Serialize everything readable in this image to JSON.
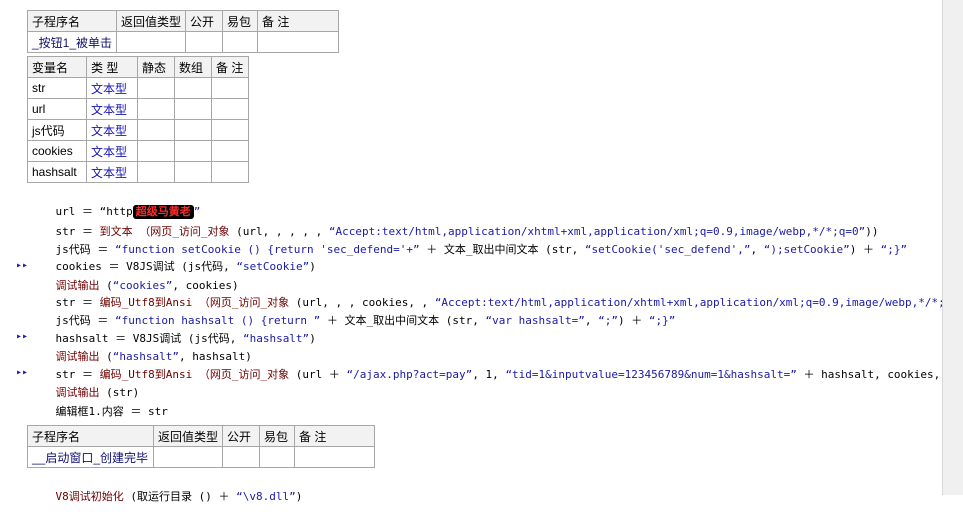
{
  "sub1": {
    "headers": [
      "子程序名",
      "返回值类型",
      "公开",
      "易包",
      "备 注"
    ],
    "name": "_按钮1_被单击"
  },
  "vars": {
    "headers": [
      "变量名",
      "类 型",
      "静态",
      "数组",
      "备 注"
    ],
    "rows": [
      {
        "name": "str",
        "type": "文本型"
      },
      {
        "name": "url",
        "type": "文本型"
      },
      {
        "name": "js代码",
        "type": "文本型"
      },
      {
        "name": "cookies",
        "type": "文本型"
      },
      {
        "name": "hashsalt",
        "type": "文本型"
      }
    ]
  },
  "code": {
    "l1_a": "url ＝ “http",
    "l1_redact": "超级马黄老",
    "l1_b": "”",
    "l2_a": "str ＝ ",
    "l2_fn": "到文本 （网页_访问_对象",
    "l2_b": " (url, , , , , ",
    "l2_str": "“Accept:text/html,application/xhtml+xml,application/xml;q=0.9,image/webp,*/*;q=0”",
    "l2_c": "))",
    "l3_a": "js代码 ＝ ",
    "l3_str1": "“function setCookie () {return 'sec_defend='+”",
    "l3_b": " ＋ 文本_取出中间文本 (str, ",
    "l3_str2": "“setCookie('sec_defend',”",
    "l3_c": ", ",
    "l3_str3": "“);setCookie”",
    "l3_d": ") ＋ ",
    "l3_str4": "“;}”",
    "l4_a": "cookies ＝ V8JS调试 (js代码, ",
    "l4_str": "“setCookie”",
    "l4_b": ")",
    "l5_fn": "调试输出",
    "l5_a": " (",
    "l5_str": "“cookies”",
    "l5_b": ", cookies)",
    "l6_a": "str ＝ ",
    "l6_fn": "编码_Utf8到Ansi （网页_访问_对象",
    "l6_b": " (url, , , cookies, , ",
    "l6_str": "“Accept:text/html,application/xhtml+xml,application/xml;q=0.9,image/webp,*/*;q=0”",
    "l6_c": "))",
    "l7_a": "js代码 ＝ ",
    "l7_str1": "“function hashsalt () {return ”",
    "l7_b": " ＋ 文本_取出中间文本 (str, ",
    "l7_str2": "“var hashsalt=”",
    "l7_c": ", ",
    "l7_str3": "“;”",
    "l7_d": ") ＋ ",
    "l7_str4": "“;}”",
    "l8_a": "hashsalt ＝ V8JS调试 (js代码, ",
    "l8_str": "“hashsalt”",
    "l8_b": ")",
    "l9_fn": "调试输出",
    "l9_a": " (",
    "l9_str": "“hashsalt”",
    "l9_b": ", hashsalt)",
    "l10_a": "str ＝ ",
    "l10_fn": "编码_Utf8到Ansi （网页_访问_对象",
    "l10_b": " (url ＋ ",
    "l10_str1": "“/ajax.php?act=pay”",
    "l10_c": ", 1, ",
    "l10_str2": "“tid=1&inputvalue=123456789&num=1&hashsalt=”",
    "l10_d": " ＋ hashsalt, cookies, , ))",
    "l11_fn": "调试输出",
    "l11_a": " (str)",
    "l12": "编辑框1.内容 ＝ str"
  },
  "sub2": {
    "headers": [
      "子程序名",
      "返回值类型",
      "公开",
      "易包",
      "备 注"
    ],
    "name": "__启动窗口_创建完毕"
  },
  "last_line": {
    "fn": "V8调试初始化",
    "a": " (取运行目录 () ＋ ",
    "str": "“\\v8.dll”",
    "b": ")"
  }
}
